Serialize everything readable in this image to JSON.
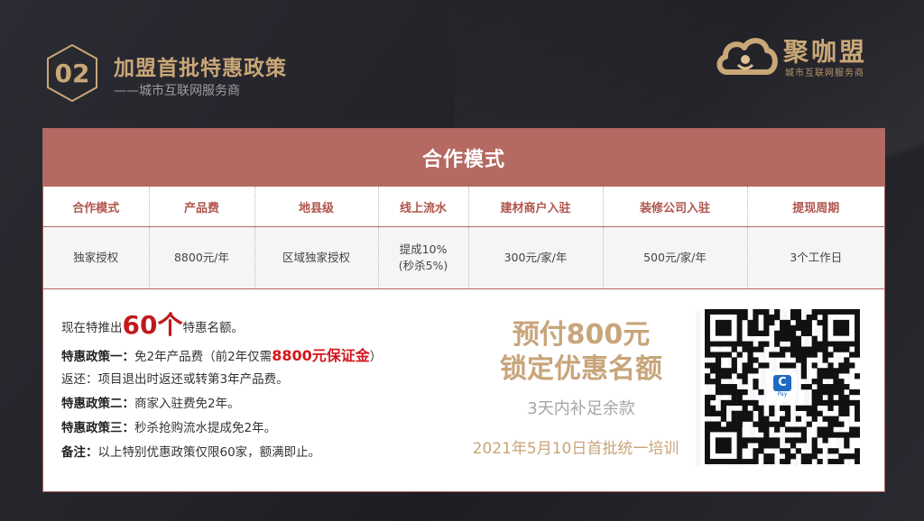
{
  "header": {
    "badge_number": "02",
    "title": "加盟首批特惠政策",
    "subtitle": "——城市互联网服务商"
  },
  "logo": {
    "name": "聚咖盟",
    "tagline": "城市互联网服务商"
  },
  "card": {
    "heading": "合作模式",
    "table": {
      "headers": [
        "合作模式",
        "产品费",
        "地县级",
        "线上流水",
        "建材商户入驻",
        "装修公司入驻",
        "提现周期"
      ],
      "row": [
        "独家授权",
        "8800元/年",
        "区域独家授权",
        "提成10%\n(秒杀5%)",
        "300元/家/年",
        "500元/家/年",
        "3个工作日"
      ]
    },
    "policy": {
      "intro_prefix": "现在特推出",
      "intro_highlight": "60个",
      "intro_suffix": "特惠名额。",
      "p1_label": "特惠政策一：",
      "p1_text": "免2年产品费（前2年仅需",
      "p1_highlight": "8800元保证金",
      "p1_close": "）",
      "refund": "返还：项目退出时返还或转第3年产品费。",
      "p2_label": "特惠政策二：",
      "p2_text": "商家入驻费免2年。",
      "p3_label": "特惠政策三：",
      "p3_text": "秒杀抢购流水提成免2年。",
      "note_label": "备注：",
      "note_text": "以上特别优惠政策仅限60家，额满即止。"
    },
    "promo": {
      "line1": "预付800元",
      "line2": "锁定优惠名额",
      "line3": "3天内补足余款",
      "line4": "2021年5月10日首批统一培训"
    },
    "qr_icon": "qr-code-icon",
    "pay_badge": "Pay"
  },
  "colors": {
    "gold": "#c9a777",
    "header_red": "#b46a62",
    "accent_red": "#c0191c"
  }
}
